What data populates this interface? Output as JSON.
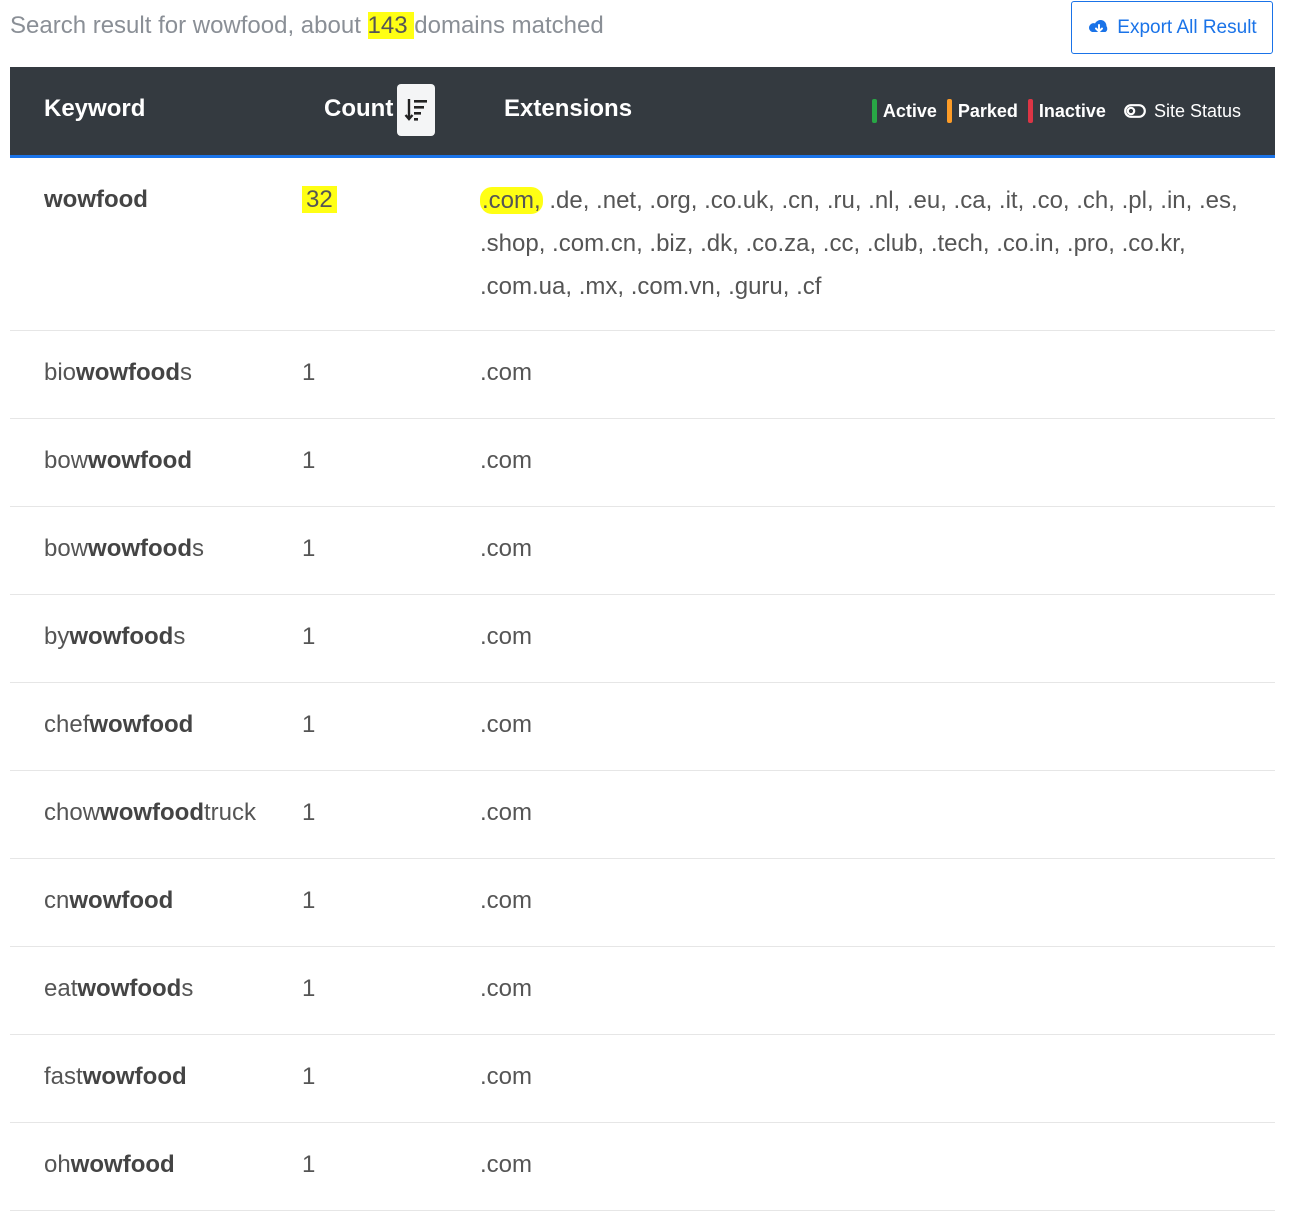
{
  "summary": {
    "prefix": "Search result for wowfood, about ",
    "count": "143 ",
    "suffix": "domains matched"
  },
  "export_button": {
    "label": "Export All Result",
    "icon": "cloud-download-icon"
  },
  "header": {
    "keyword": "Keyword",
    "count": "Count",
    "extensions": "Extensions",
    "legend": {
      "active": "Active",
      "parked": "Parked",
      "inactive": "Inactive",
      "site_status": "Site Status"
    },
    "colors": {
      "active": "#28a745",
      "parked": "#fd9c27",
      "inactive": "#dc3545",
      "accent": "#1a73e8"
    }
  },
  "first_row": {
    "keyword": "wowfood",
    "count": "32",
    "ext_first": ".com,",
    "ext_rest": " .de, .net, .org, .co.uk, .cn, .ru, .nl, .eu, .ca, .it, .co, .ch, .pl, .in, .es, .shop, .com.cn, .biz, .dk, .co.za, .cc, .club, .tech, .co.in, .pro, .co.kr, .com.ua, .mx, .com.vn, .guru, .cf"
  },
  "rows": [
    {
      "pre": "bio",
      "bold": "wowfood",
      "post": "s",
      "count": "1",
      "ext": ".com"
    },
    {
      "pre": "bow",
      "bold": "wowfood",
      "post": "",
      "count": "1",
      "ext": ".com"
    },
    {
      "pre": "bow",
      "bold": "wowfood",
      "post": "s",
      "count": "1",
      "ext": ".com"
    },
    {
      "pre": "by",
      "bold": "wowfood",
      "post": "s",
      "count": "1",
      "ext": ".com"
    },
    {
      "pre": "chef",
      "bold": "wowfood",
      "post": "",
      "count": "1",
      "ext": ".com"
    },
    {
      "pre": "chow",
      "bold": "wowfood",
      "post": "truck",
      "count": "1",
      "ext": ".com"
    },
    {
      "pre": "cn",
      "bold": "wowfood",
      "post": "",
      "count": "1",
      "ext": ".com"
    },
    {
      "pre": "eat",
      "bold": "wowfood",
      "post": "s",
      "count": "1",
      "ext": ".com"
    },
    {
      "pre": "fast",
      "bold": "wowfood",
      "post": "",
      "count": "1",
      "ext": ".com"
    },
    {
      "pre": "oh",
      "bold": "wowfood",
      "post": "",
      "count": "1",
      "ext": ".com"
    }
  ]
}
